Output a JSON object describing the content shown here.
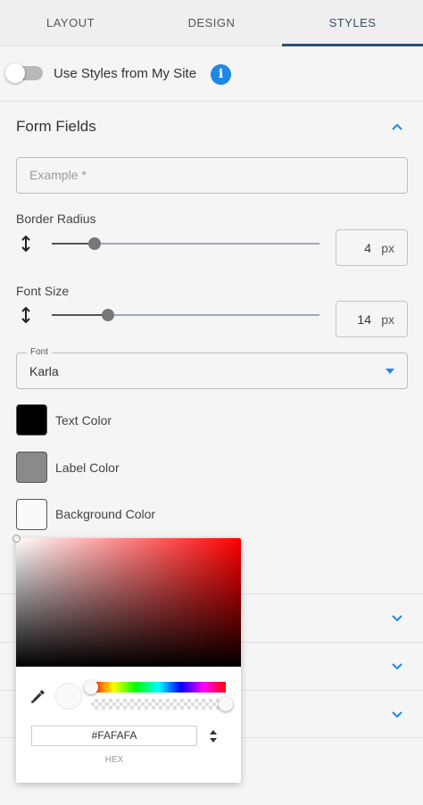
{
  "tabs": [
    {
      "label": "LAYOUT"
    },
    {
      "label": "DESIGN"
    },
    {
      "label": "STYLES"
    }
  ],
  "active_tab": "STYLES",
  "site_styles": {
    "label": "Use Styles from My Site",
    "enabled": false,
    "info_icon": "i"
  },
  "form_fields": {
    "title": "Form Fields",
    "expanded": true,
    "example_placeholder": "Example *",
    "border_radius": {
      "label": "Border Radius",
      "value": "4",
      "unit": "px",
      "slider_fraction": 0.16
    },
    "font_size": {
      "label": "Font Size",
      "value": "14",
      "unit": "px",
      "slider_fraction": 0.21
    },
    "font": {
      "legend": "Font",
      "value": "Karla"
    },
    "colors": [
      {
        "label": "Text Color",
        "color": "#000000"
      },
      {
        "label": "Label Color",
        "color": "#8a8a8a"
      },
      {
        "label": "Background Color",
        "color": "#fafafa"
      }
    ]
  },
  "collapsed_sections": [
    {
      "expanded": false
    },
    {
      "expanded": false
    },
    {
      "expanded": false
    }
  ],
  "color_picker": {
    "hex_value": "#FAFAFA",
    "mode_label": "HEX",
    "hue": 0,
    "alpha": 1.0
  },
  "theme": {
    "accent": "#1e88e5",
    "tab_underline": "#2f4a78"
  }
}
